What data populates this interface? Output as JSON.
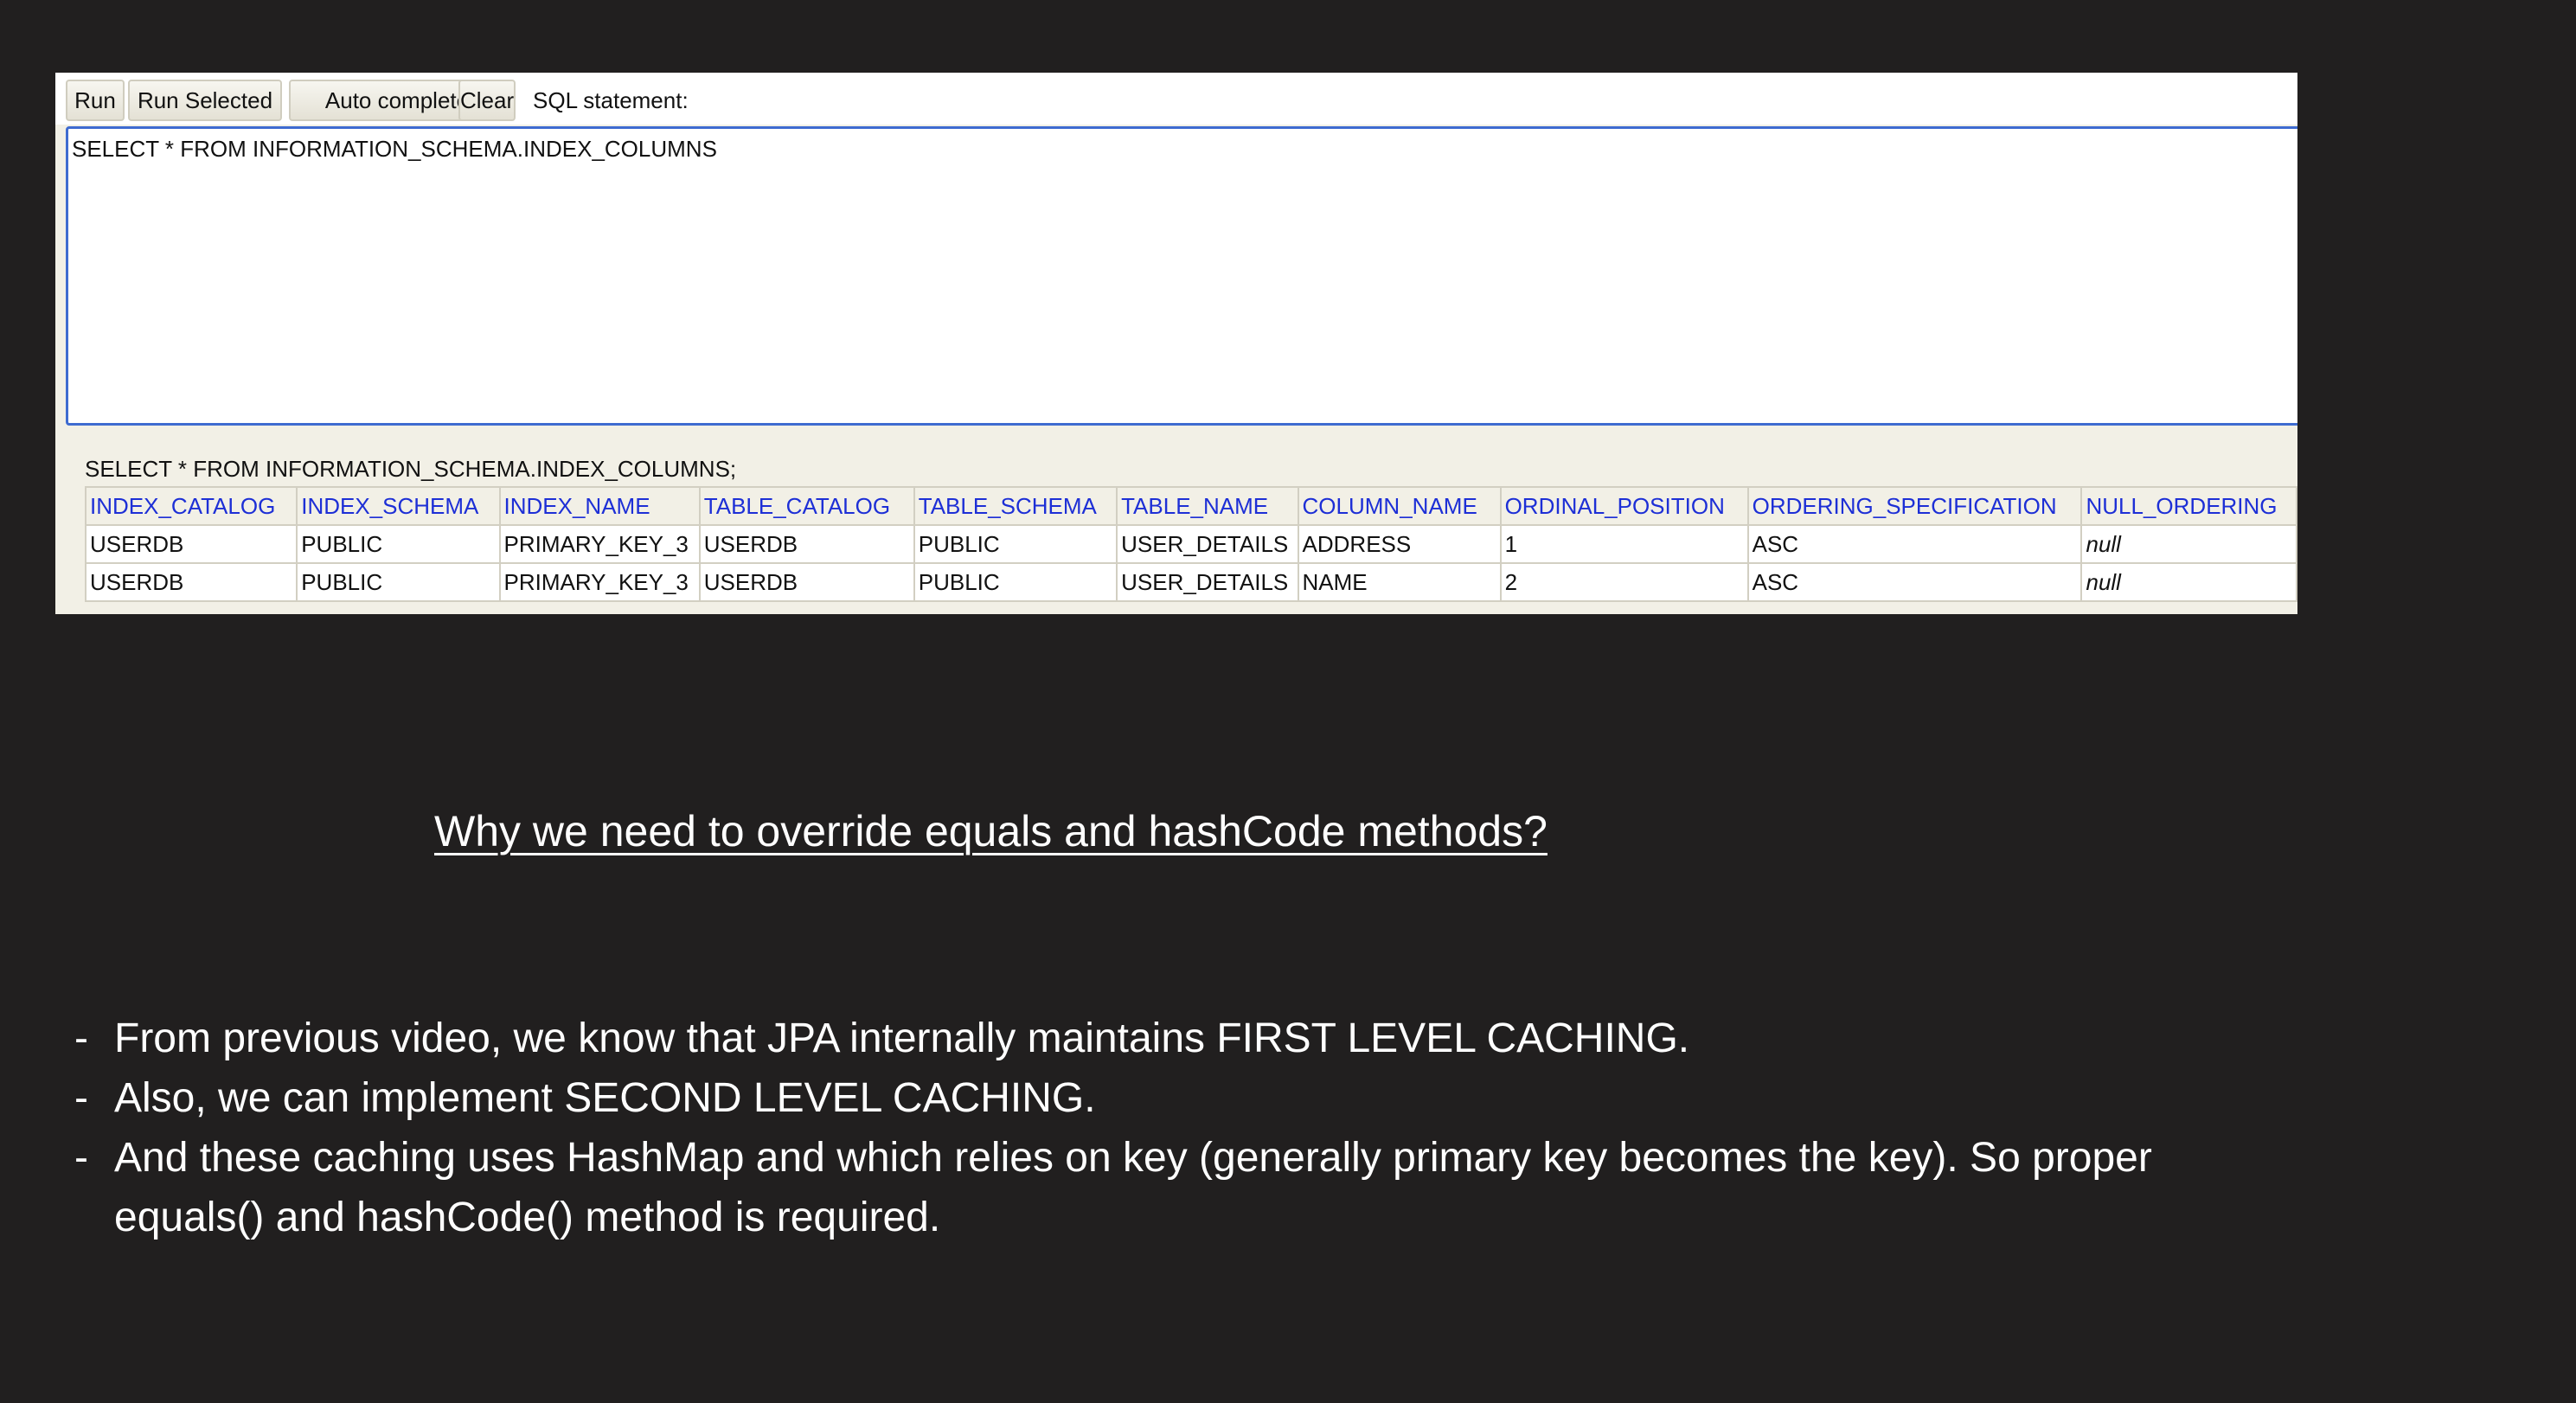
{
  "toolbar": {
    "run_label": "Run",
    "run_selected_label": "Run Selected",
    "auto_complete_label": "Auto complete",
    "clear_label": "Clear",
    "sql_statement_label": "SQL statement:"
  },
  "editor": {
    "value": "SELECT * FROM INFORMATION_SCHEMA.INDEX_COLUMNS "
  },
  "result": {
    "executed_sql": "SELECT * FROM INFORMATION_SCHEMA.INDEX_COLUMNS;",
    "columns": [
      "INDEX_CATALOG",
      "INDEX_SCHEMA",
      "INDEX_NAME",
      "TABLE_CATALOG",
      "TABLE_SCHEMA",
      "TABLE_NAME",
      "COLUMN_NAME",
      "ORDINAL_POSITION",
      "ORDERING_SPECIFICATION",
      "NULL_ORDERING"
    ],
    "rows": [
      [
        "USERDB",
        "PUBLIC",
        "PRIMARY_KEY_3",
        "USERDB",
        "PUBLIC",
        "USER_DETAILS",
        "ADDRESS",
        "1",
        "ASC",
        "null"
      ],
      [
        "USERDB",
        "PUBLIC",
        "PRIMARY_KEY_3",
        "USERDB",
        "PUBLIC",
        "USER_DETAILS",
        "NAME",
        "2",
        "ASC",
        "null"
      ]
    ]
  },
  "slide": {
    "heading": "Why we need to override equals and hashCode methods?",
    "bullet_marker": "-",
    "bullets": [
      "From previous video, we know that JPA internally maintains FIRST LEVEL CACHING.",
      "Also, we can implement SECOND LEVEL CACHING.",
      "And these caching uses HashMap and which relies on key (generally primary key becomes the key). So proper equals() and hashCode() method is required."
    ]
  }
}
